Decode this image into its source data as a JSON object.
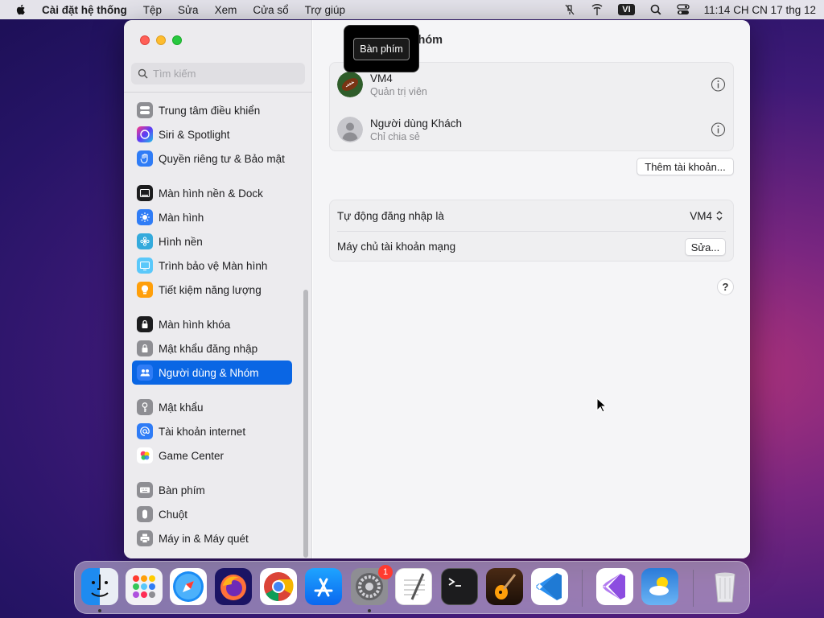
{
  "menubar": {
    "app_name": "Cài đặt hệ thống",
    "items": [
      "Tệp",
      "Sửa",
      "Xem",
      "Cửa sổ",
      "Trợ giúp"
    ],
    "input_source": "VI",
    "clock": "11:14 CH CN 17 thg 12",
    "icons": [
      "apple-icon",
      "mic-muted-icon",
      "network-icon",
      "input-source-icon",
      "spotlight-search-icon",
      "control-center-icon"
    ]
  },
  "sidebar": {
    "search_placeholder": "Tìm kiếm",
    "items": [
      {
        "label": "Trung tâm điều khiển",
        "icon": "control-center-icon",
        "color": "#8e8e93"
      },
      {
        "label": "Siri & Spotlight",
        "icon": "siri-icon",
        "color": "#a23be0"
      },
      {
        "label": "Quyền riêng tư & Bảo mật",
        "icon": "hand-icon",
        "color": "#2f7cf6"
      },
      {
        "label": "Màn hình nền & Dock",
        "icon": "dock-icon",
        "color": "#1c1c1e"
      },
      {
        "label": "Màn hình",
        "icon": "sun-icon",
        "color": "#2f7cf6"
      },
      {
        "label": "Hình nền",
        "icon": "wallpaper-icon",
        "color": "#34aadc"
      },
      {
        "label": "Trình bảo vệ Màn hình",
        "icon": "screensaver-icon",
        "color": "#5ac8fa"
      },
      {
        "label": "Tiết kiệm năng lượng",
        "icon": "lightbulb-icon",
        "color": "#ff9f0a"
      },
      {
        "label": "Màn hình khóa",
        "icon": "lock-screen-icon",
        "color": "#1c1c1e"
      },
      {
        "label": "Mật khẩu đăng nhập",
        "icon": "lock-icon",
        "color": "#8e8e93"
      },
      {
        "label": "Người dùng & Nhóm",
        "icon": "users-icon",
        "color": "#2f7cf6",
        "selected": true
      },
      {
        "label": "Mật khẩu",
        "icon": "key-icon",
        "color": "#8e8e93"
      },
      {
        "label": "Tài khoản internet",
        "icon": "at-icon",
        "color": "#2f7cf6"
      },
      {
        "label": "Game Center",
        "icon": "game-center-icon",
        "color": "#ffffff"
      },
      {
        "label": "Bàn phím",
        "icon": "keyboard-icon",
        "color": "#8e8e93"
      },
      {
        "label": "Chuột",
        "icon": "mouse-icon",
        "color": "#8e8e93"
      },
      {
        "label": "Máy in & Máy quét",
        "icon": "printer-icon",
        "color": "#8e8e93"
      }
    ]
  },
  "main": {
    "title_suffix": "Nhóm",
    "users": [
      {
        "name": "VM4",
        "role": "Quản trị viên",
        "avatar": "football-avatar"
      },
      {
        "name": "Người dùng Khách",
        "role": "Chỉ chia sẻ",
        "avatar": "guest-avatar"
      }
    ],
    "add_account_button": "Thêm tài khoản...",
    "auto_login_label": "Tự động đăng nhập là",
    "auto_login_value": "VM4",
    "network_server_label": "Máy chủ tài khoản mạng",
    "edit_button": "Sửa...",
    "help_button": "?"
  },
  "tooltip": {
    "text": "Bàn phím"
  },
  "dock": {
    "apps": [
      "Finder",
      "Launchpad",
      "Safari",
      "Firefox",
      "Chrome",
      "App Store",
      "System Settings",
      "TextEdit",
      "Terminal",
      "GarageBand",
      "Visual Studio Code",
      "Visual Studio",
      "Weather",
      "Trash"
    ],
    "settings_badge": "1"
  }
}
